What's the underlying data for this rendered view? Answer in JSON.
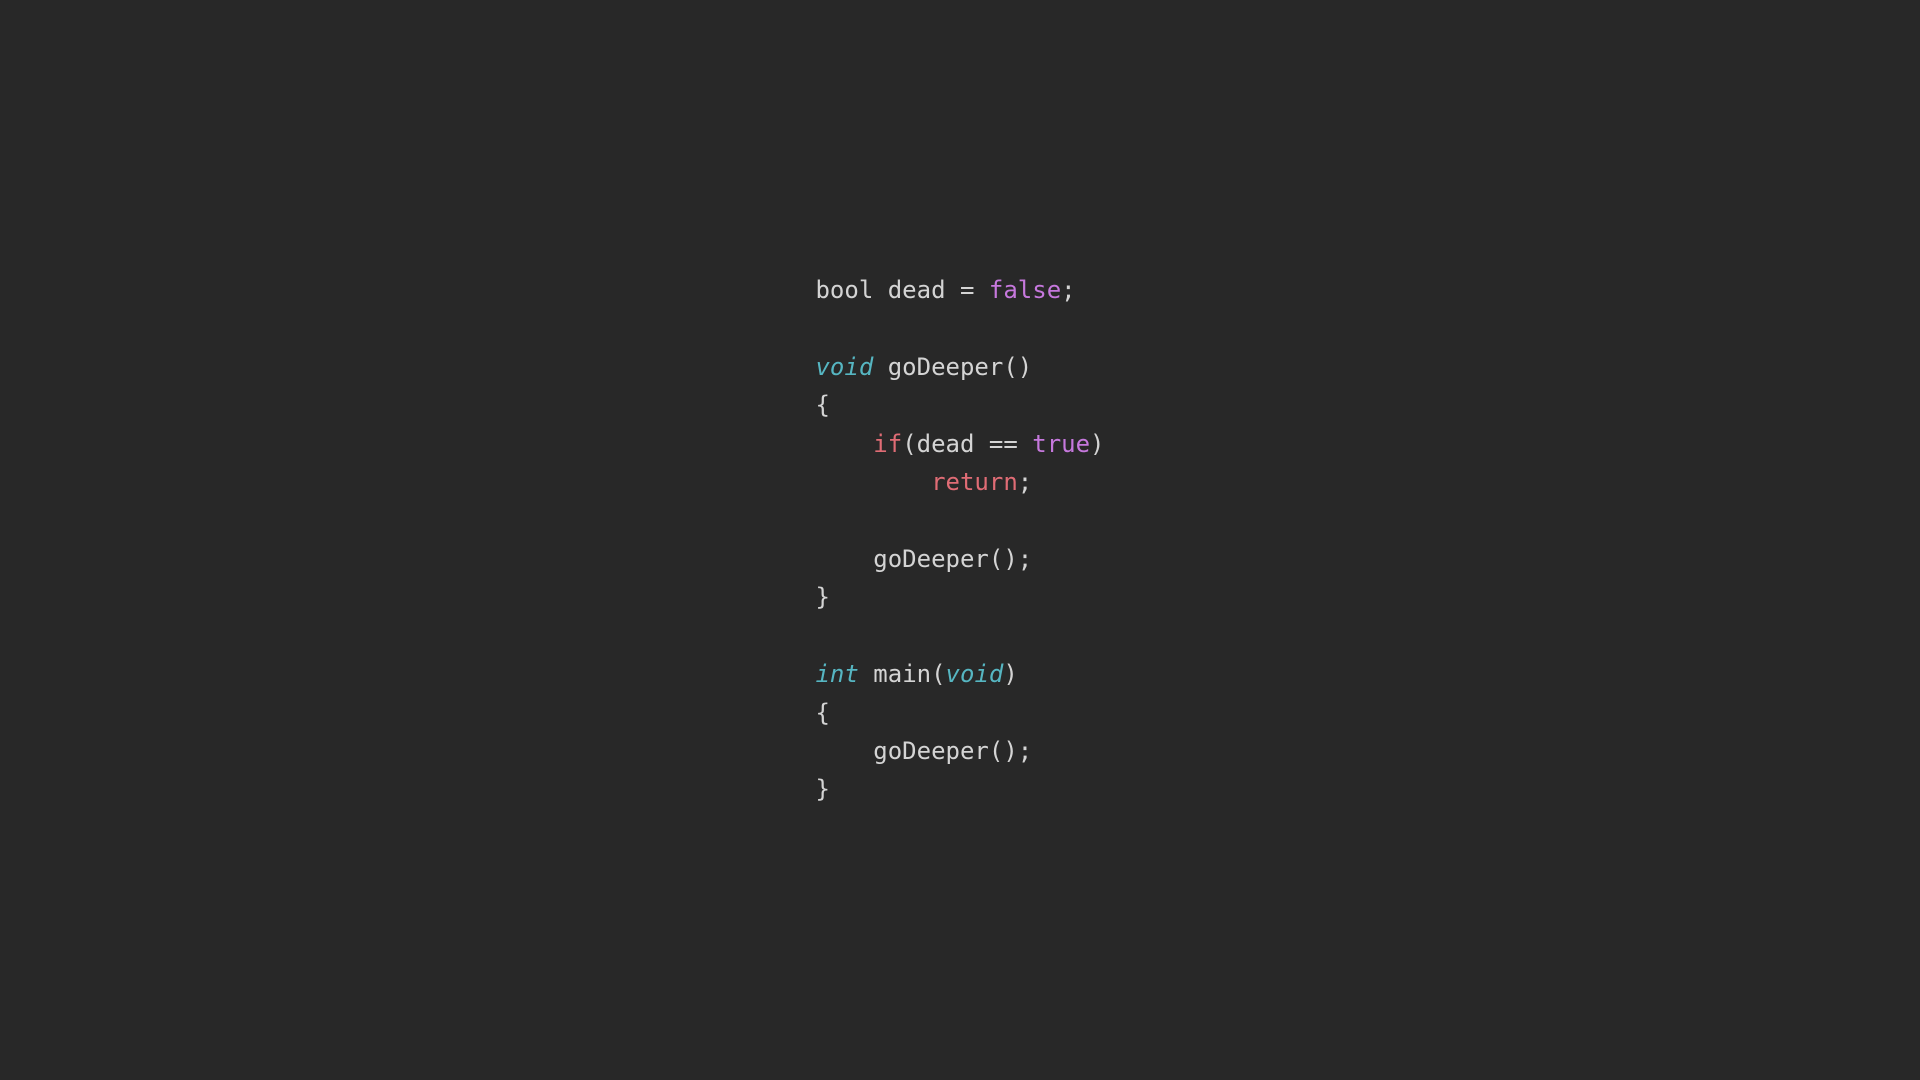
{
  "code": {
    "tokens": [
      {
        "text": "bool",
        "cls": "tok-default"
      },
      {
        "text": " ",
        "cls": "tok-default"
      },
      {
        "text": "dead",
        "cls": "tok-default"
      },
      {
        "text": " ",
        "cls": "tok-default"
      },
      {
        "text": "=",
        "cls": "tok-default"
      },
      {
        "text": " ",
        "cls": "tok-default"
      },
      {
        "text": "false",
        "cls": "tok-literal"
      },
      {
        "text": ";",
        "cls": "tok-default"
      },
      {
        "text": "\n\n",
        "cls": "tok-default"
      },
      {
        "text": "void",
        "cls": "tok-type"
      },
      {
        "text": " ",
        "cls": "tok-default"
      },
      {
        "text": "goDeeper",
        "cls": "tok-default"
      },
      {
        "text": "()",
        "cls": "tok-default"
      },
      {
        "text": "\n",
        "cls": "tok-default"
      },
      {
        "text": "{",
        "cls": "tok-default"
      },
      {
        "text": "\n    ",
        "cls": "tok-default"
      },
      {
        "text": "if",
        "cls": "tok-keyword"
      },
      {
        "text": "(",
        "cls": "tok-default"
      },
      {
        "text": "dead",
        "cls": "tok-default"
      },
      {
        "text": " ",
        "cls": "tok-default"
      },
      {
        "text": "==",
        "cls": "tok-default"
      },
      {
        "text": " ",
        "cls": "tok-default"
      },
      {
        "text": "true",
        "cls": "tok-literal"
      },
      {
        "text": ")",
        "cls": "tok-default"
      },
      {
        "text": "\n        ",
        "cls": "tok-default"
      },
      {
        "text": "return",
        "cls": "tok-keyword"
      },
      {
        "text": ";",
        "cls": "tok-default"
      },
      {
        "text": "\n\n    ",
        "cls": "tok-default"
      },
      {
        "text": "goDeeper",
        "cls": "tok-default"
      },
      {
        "text": "();",
        "cls": "tok-default"
      },
      {
        "text": "\n",
        "cls": "tok-default"
      },
      {
        "text": "}",
        "cls": "tok-default"
      },
      {
        "text": "\n\n",
        "cls": "tok-default"
      },
      {
        "text": "int",
        "cls": "tok-type"
      },
      {
        "text": " ",
        "cls": "tok-default"
      },
      {
        "text": "main",
        "cls": "tok-default"
      },
      {
        "text": "(",
        "cls": "tok-default"
      },
      {
        "text": "void",
        "cls": "tok-type"
      },
      {
        "text": ")",
        "cls": "tok-default"
      },
      {
        "text": "\n",
        "cls": "tok-default"
      },
      {
        "text": "{",
        "cls": "tok-default"
      },
      {
        "text": "\n    ",
        "cls": "tok-default"
      },
      {
        "text": "goDeeper",
        "cls": "tok-default"
      },
      {
        "text": "();",
        "cls": "tok-default"
      },
      {
        "text": "\n",
        "cls": "tok-default"
      },
      {
        "text": "}",
        "cls": "tok-default"
      }
    ]
  }
}
